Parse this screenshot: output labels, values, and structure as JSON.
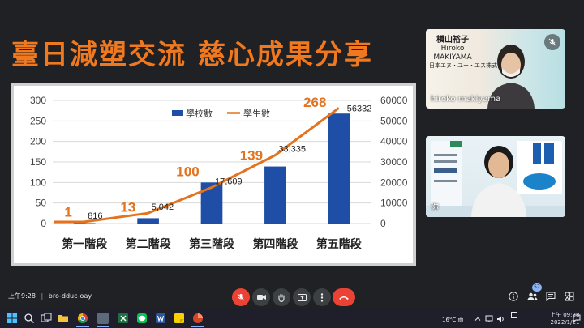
{
  "slide": {
    "title": "臺日減塑交流 慈心成果分享"
  },
  "chart_data": {
    "type": "bar",
    "categories": [
      "第一階段",
      "第二階段",
      "第三階段",
      "第四階段",
      "第五階段"
    ],
    "series": [
      {
        "name": "學校數",
        "kind": "bar",
        "axis": "left",
        "values": [
          1,
          13,
          100,
          139,
          268
        ],
        "labels": [
          "1",
          "13",
          "100",
          "139",
          "268"
        ]
      },
      {
        "name": "學生數",
        "kind": "line",
        "axis": "right",
        "values": [
          816,
          5042,
          17609,
          33335,
          56332
        ],
        "labels": [
          "816",
          "5,042",
          "17,609",
          "33,335",
          "56332"
        ]
      }
    ],
    "ylim_left": [
      0,
      300
    ],
    "ylim_right": [
      0,
      60000
    ],
    "left_ticks": [
      "0",
      "50",
      "100",
      "150",
      "200",
      "250",
      "300"
    ],
    "right_ticks": [
      "0",
      "10000",
      "20000",
      "30000",
      "40000",
      "50000",
      "60000"
    ],
    "legend_position": "top-center",
    "grid": true,
    "colors": {
      "bar": "#1f4ea6",
      "line": "#e3731f",
      "bar_label": "#e3731f"
    }
  },
  "participants": [
    {
      "display_name": "hiroko makiyama",
      "card_name_zh": "槇山裕子",
      "card_name_en_1": "Hiroko",
      "card_name_en_2": "MAKIYAMA",
      "card_company": "日本エヌ・ユー・エス株式会社",
      "muted": true
    },
    {
      "display_name": "你",
      "muted": false
    }
  ],
  "meeting": {
    "time": "上午9:28",
    "separator": "|",
    "code": "bro-dduc-oay",
    "people_count": "57",
    "controls": [
      "mic-off",
      "camera",
      "raise-hand",
      "present",
      "more",
      "leave-call"
    ],
    "side_controls": [
      "info",
      "people",
      "chat",
      "activities"
    ]
  },
  "taskbar": {
    "weather": "16°C 雨",
    "time_line1": "上午 09:28",
    "time_line2": "2022/1/21",
    "apps": [
      "windows",
      "search",
      "task-view",
      "file-explorer",
      "chrome",
      "excel",
      "line",
      "word",
      "powerpoint-app",
      "folder",
      "powerpoint"
    ]
  }
}
